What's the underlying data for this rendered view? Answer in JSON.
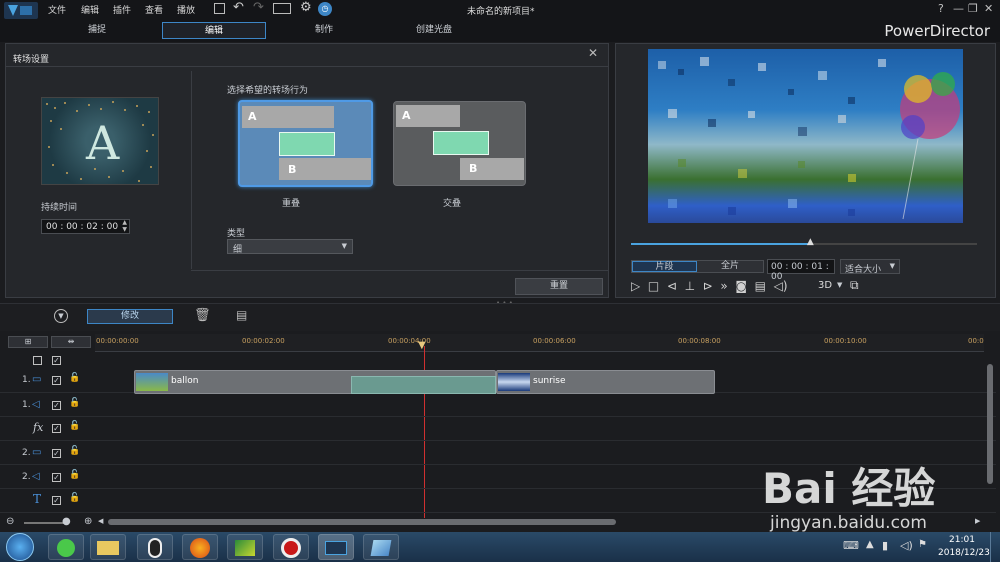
{
  "menu": [
    "文件",
    "编辑",
    "插件",
    "查看",
    "播放"
  ],
  "project_title": "未命名的新项目*",
  "help": "?",
  "brand": "PowerDirector",
  "tabs": [
    "捕捉",
    "编辑",
    "制作",
    "创建光盘"
  ],
  "transition": {
    "title": "转场设置",
    "duration_label": "持续时间",
    "duration_value": "00 : 00 : 02 : 00",
    "behavior_label": "选择希望的转场行为",
    "option_overlap": "重叠",
    "option_cross": "交叠",
    "type_label": "类型",
    "type_value": "细",
    "reset_button": "重置",
    "thumb_letter": "A",
    "label_a": "A",
    "label_b": "B"
  },
  "preview": {
    "mode_clip": "片段",
    "mode_full": "全片",
    "timecode": "00 : 00 : 01 : 00",
    "fit": "适合大小",
    "three_d": "3D",
    "scrub_fraction": 0.52
  },
  "toolbar": {
    "modify": "修改"
  },
  "ruler": [
    "00:00:00:00",
    "00:00:02:00",
    "00:00:04:00",
    "00:00:06:00",
    "00:00:08:00",
    "00:00:10:00",
    "00:0"
  ],
  "tracks": [
    {
      "label": "1.",
      "icon": "video-icon"
    },
    {
      "label": "1.",
      "icon": "audio-icon"
    },
    {
      "label": "fx",
      "icon": "fx-icon"
    },
    {
      "label": "2.",
      "icon": "video-icon"
    },
    {
      "label": "2.",
      "icon": "audio-icon"
    },
    {
      "label": "T",
      "icon": "title-icon"
    }
  ],
  "clips": [
    {
      "name": "ballon"
    },
    {
      "name": "sunrise"
    }
  ],
  "clock": {
    "time": "21:01",
    "date": "2018/12/23"
  },
  "watermark": {
    "main": "Bai 经验",
    "url": "jingyan.baidu.com"
  },
  "colors": {
    "accent": "#3d86c6",
    "selected_option": "#5b8ab8",
    "transition_bar": "#7fd8b0"
  }
}
